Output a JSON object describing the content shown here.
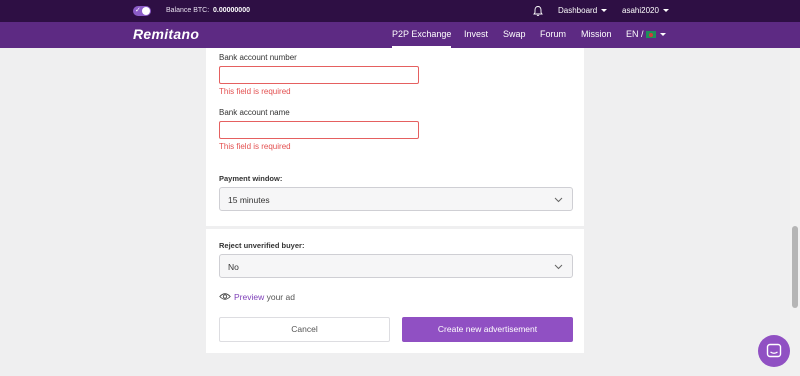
{
  "topbar": {
    "balance_label": "Balance BTC:",
    "balance_value": "0.00000000",
    "dashboard": "Dashboard",
    "username": "asahi2020"
  },
  "nav": {
    "logo": "Remitano",
    "items": [
      "P2P Exchange",
      "Invest",
      "Swap",
      "Forum",
      "Mission"
    ],
    "active_item": "P2P Exchange",
    "language": "EN /"
  },
  "form": {
    "bank_account_number": {
      "label": "Bank account number",
      "value": "",
      "error": "This field is required"
    },
    "bank_account_name": {
      "label": "Bank account name",
      "value": "",
      "error": "This field is required"
    },
    "payment_window": {
      "label": "Payment window:",
      "value": "15 minutes"
    },
    "reject_unverified": {
      "label": "Reject unverified buyer:",
      "value": "No"
    },
    "preview": {
      "link": "Preview",
      "text": " your ad"
    },
    "cancel_label": "Cancel",
    "create_label": "Create new advertisement"
  },
  "colors": {
    "topbar": "#2e0f44",
    "navbar": "#5d2a83",
    "primary": "#9050c3",
    "error": "#e35050"
  },
  "icons": {
    "toggle": "toggle-icon",
    "bell": "bell-icon",
    "flag": "flag-icon",
    "chevron": "chevron-down-icon",
    "eye": "eye-icon",
    "chat": "chat-icon"
  }
}
